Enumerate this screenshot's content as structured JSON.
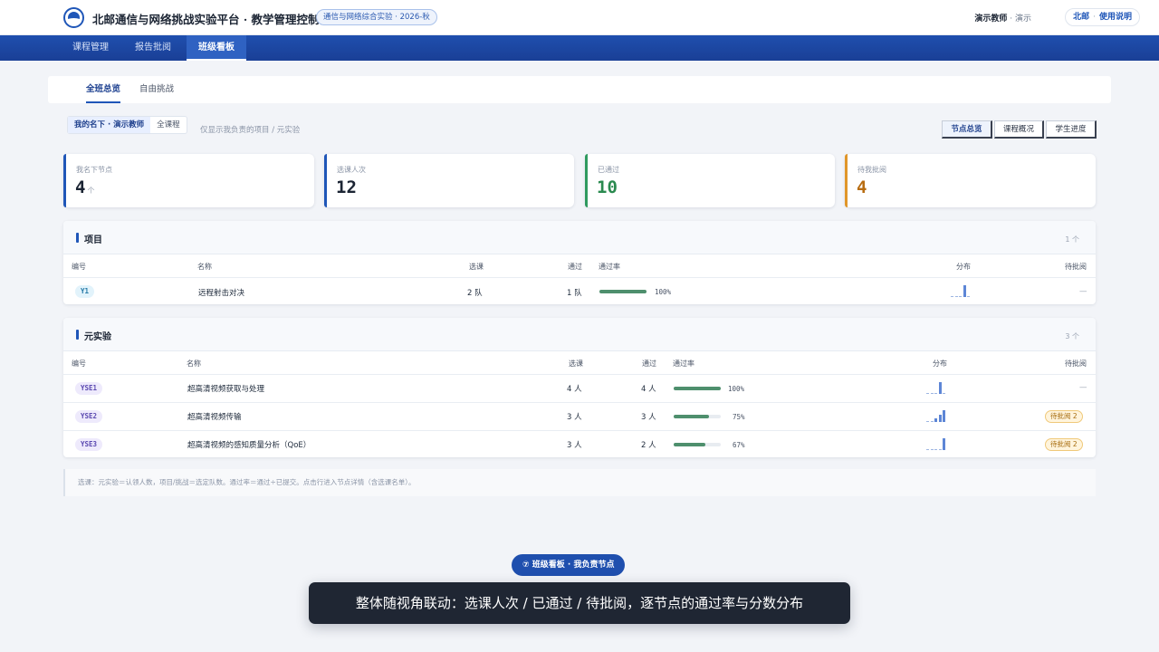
{
  "header": {
    "app_title": "北邮通信与网络挑战实验平台 · 教学管理控制台",
    "course_badge": "通信与网络综合实验 · 2026-秋",
    "user_name": "演示教师",
    "user_role": "· 演示",
    "org_label": "北邮",
    "help_label": "使用说明"
  },
  "nav": {
    "tabs": [
      "课程管理",
      "报告批阅",
      "班级看板"
    ],
    "active": "班级看板"
  },
  "subtabs": {
    "items": [
      "全班总览",
      "自由挑战"
    ],
    "active": "全班总览"
  },
  "scope": {
    "mine_label": "我的名下 · 演示教师",
    "all_label": "全课程",
    "note": "仅显示我负责的项目 / 元实验"
  },
  "view_switch": {
    "items": [
      "节点总览",
      "课程概况",
      "学生进度"
    ],
    "active": "节点总览"
  },
  "stats": [
    {
      "label": "我名下节点",
      "value": "4",
      "unit": "个",
      "color": "#1f56b8",
      "value_color": "#1b2433"
    },
    {
      "label": "选课人次",
      "value": "12",
      "unit": "",
      "color": "#1f56b8",
      "value_color": "#1b2433"
    },
    {
      "label": "已通过",
      "value": "10",
      "unit": "",
      "color": "#2f9a5f",
      "value_color": "#2a8a4f"
    },
    {
      "label": "待我批阅",
      "value": "4",
      "unit": "",
      "color": "#e0962a",
      "value_color": "#b86d12"
    }
  ],
  "projects": {
    "title": "项目",
    "count": "1 个",
    "columns": [
      "编号",
      "名称",
      "选课",
      "通过",
      "通过率",
      "分布",
      "待批阅"
    ],
    "rows": [
      {
        "code": "Y1",
        "name": "远程射击对决",
        "enrolled": "2 队",
        "passed": "1 队",
        "rate": 1.0,
        "rate_text": "100%",
        "dist": [
          0,
          0,
          0,
          1,
          0
        ],
        "pending": "—"
      }
    ]
  },
  "meta_experiments": {
    "title": "元实验",
    "count": "3 个",
    "columns": [
      "编号",
      "名称",
      "选课",
      "通过",
      "通过率",
      "分布",
      "待批阅"
    ],
    "rows": [
      {
        "code": "YSE1",
        "name": "超高清视频获取与处理",
        "enrolled": "4 人",
        "passed": "4 人",
        "rate": 1.0,
        "rate_text": "100%",
        "dist": [
          0,
          0,
          0,
          1,
          0
        ],
        "pending": "—"
      },
      {
        "code": "YSE2",
        "name": "超高清视频传输",
        "enrolled": "3 人",
        "passed": "3 人",
        "rate": 0.75,
        "rate_text": "75%",
        "dist": [
          0,
          0,
          0.3,
          0.6,
          1
        ],
        "pending": "待批阅 2"
      },
      {
        "code": "YSE3",
        "name": "超高清视频的感知质量分析（QoE）",
        "enrolled": "3 人",
        "passed": "2 人",
        "rate": 0.67,
        "rate_text": "67%",
        "dist": [
          0,
          0,
          0,
          0,
          1
        ],
        "pending": "待批阅 2"
      }
    ]
  },
  "footnote": "选课：元实验＝认领人数，项目/挑战＝选定队数。通过率＝通过÷已提交。点击行进入节点详情（含选课名单）。",
  "step_badge": "⑦  班级看板 · 我负责节点",
  "caption": "整体随视角联动：选课人次 / 已通过 / 待批阅，逐节点的通过率与分数分布",
  "colors": {
    "brand": "#1f56b8",
    "nav_bg": "#1f4fae",
    "pass_bar": "#4e8f6d",
    "dist_bar": "#5d86d6",
    "pending_bg": "#fff4dc",
    "y_pill_bg": "#e2f3fb",
    "yse_pill_bg": "#eeeafc"
  }
}
